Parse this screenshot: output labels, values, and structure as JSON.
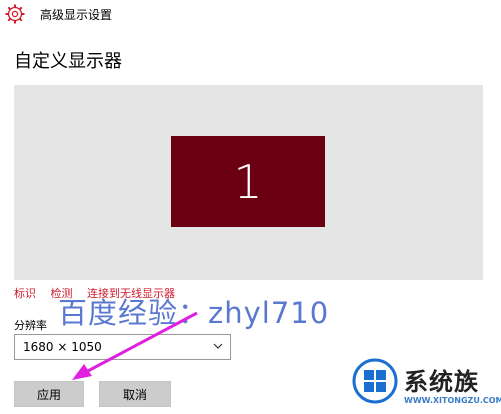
{
  "window": {
    "title": "高级显示设置"
  },
  "page": {
    "title": "自定义显示器"
  },
  "display_preview": {
    "monitor_number": "1",
    "monitor_color": "#6a0012"
  },
  "links": [
    "标识",
    "检测",
    "连接到无线显示器"
  ],
  "watermark": "百度经验：zhyl710",
  "resolution": {
    "label": "分辨率",
    "value": "1680 × 1050"
  },
  "buttons": {
    "apply": "应用",
    "cancel": "取消"
  },
  "brand": {
    "name": "系统族",
    "url": "WWW.XITONGZU.COM"
  },
  "colors": {
    "link": "#d01c2c",
    "arrow": "#e020e0",
    "watermark": "#5a78cf",
    "brand_blue": "#1a6fd0"
  }
}
